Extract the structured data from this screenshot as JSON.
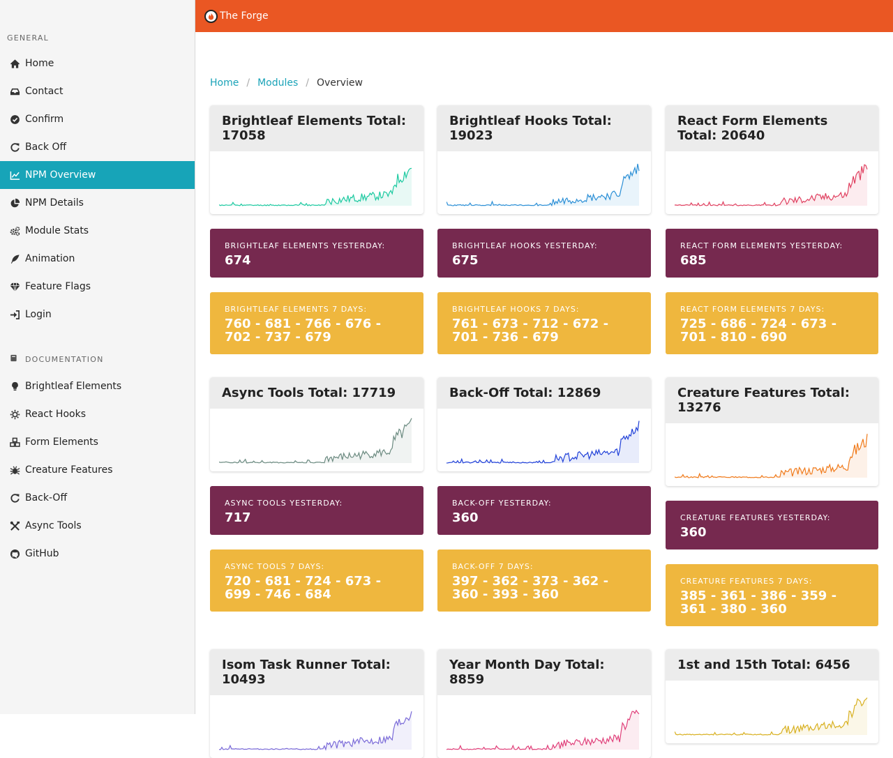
{
  "topbar": {
    "title": "The Forge"
  },
  "sidebar": {
    "general_heading": "General",
    "general_items": [
      {
        "label": "Home",
        "icon": "home-icon"
      },
      {
        "label": "Contact",
        "icon": "inbox-icon"
      },
      {
        "label": "Confirm",
        "icon": "check-circle-icon"
      },
      {
        "label": "Back Off",
        "icon": "redo-icon"
      },
      {
        "label": "NPM Overview",
        "icon": "line-chart-icon",
        "active": true
      },
      {
        "label": "NPM Details",
        "icon": "pie-chart-icon"
      },
      {
        "label": "Module Stats",
        "icon": "cogs-icon"
      },
      {
        "label": "Animation",
        "icon": "feather-icon"
      },
      {
        "label": "Feature Flags",
        "icon": "diamond-icon"
      },
      {
        "label": "Login",
        "icon": "sign-in-icon"
      }
    ],
    "docs_heading": "Documentation",
    "docs_items": [
      {
        "label": "Brightleaf Elements",
        "icon": "lightbulb-icon"
      },
      {
        "label": "React Hooks",
        "icon": "sun-icon"
      },
      {
        "label": "Form Elements",
        "icon": "cubes-icon"
      },
      {
        "label": "Creature Features",
        "icon": "bug-icon"
      },
      {
        "label": "Back-Off",
        "icon": "redo-icon"
      },
      {
        "label": "Async Tools",
        "icon": "tools-icon"
      },
      {
        "label": "GitHub",
        "icon": "github-icon"
      }
    ]
  },
  "breadcrumb": {
    "home": "Home",
    "modules": "Modules",
    "current": "Overview"
  },
  "colors": {
    "accent": "#ea5723",
    "active_nav": "#17a4b8",
    "purple": "#76294f",
    "yellow": "#efb73e"
  },
  "modules": [
    {
      "total_label": "Brightleaf Elements Total: 17058",
      "yesterday_label": "Brightleaf Elements Yesterday:",
      "yesterday_value": "674",
      "week_label": "Brightleaf Elements 7 Days:",
      "week_value": "760 - 681 - 766 - 676 - 702 - 737 - 679",
      "color": "#1bc9a0"
    },
    {
      "total_label": "Brightleaf Hooks Total: 19023",
      "yesterday_label": "Brightleaf Hooks Yesterday:",
      "yesterday_value": "675",
      "week_label": "Brightleaf Hooks 7 Days:",
      "week_value": "761 - 673 - 712 - 672 - 701 - 736 - 679",
      "color": "#2b8fd6"
    },
    {
      "total_label": "React Form Elements Total: 20640",
      "yesterday_label": "React Form Elements Yesterday:",
      "yesterday_value": "685",
      "week_label": "React Form Elements 7 Days:",
      "week_value": "725 - 686 - 724 - 673 - 701 - 810 - 690",
      "color": "#e04060"
    },
    {
      "total_label": "Async Tools Total: 17719",
      "yesterday_label": "Async Tools Yesterday:",
      "yesterday_value": "717",
      "week_label": "Async Tools 7 Days:",
      "week_value": "720 - 681 - 724 - 673 - 699 - 746 - 684",
      "color": "#6b8a80"
    },
    {
      "total_label": "Back-Off Total: 12869",
      "yesterday_label": "Back-Off Yesterday:",
      "yesterday_value": "360",
      "week_label": "Back-Off 7 Days:",
      "week_value": "397 - 362 - 373 - 362 - 360 - 393 - 360",
      "color": "#2040d8"
    },
    {
      "total_label": "Creature Features Total: 13276",
      "yesterday_label": "Creature Features Yesterday:",
      "yesterday_value": "360",
      "week_label": "Creature Features 7 Days:",
      "week_value": "385 - 361 - 386 - 359 - 361 - 380 - 360",
      "color": "#f07a1a"
    },
    {
      "total_label": "Isom Task Runner Total: 10493",
      "color": "#7a6ad8"
    },
    {
      "total_label": "Year Month Day Total: 8859",
      "color": "#e0407a"
    },
    {
      "total_label": "1st and 15th Total: 6456",
      "color": "#d8b020"
    }
  ]
}
